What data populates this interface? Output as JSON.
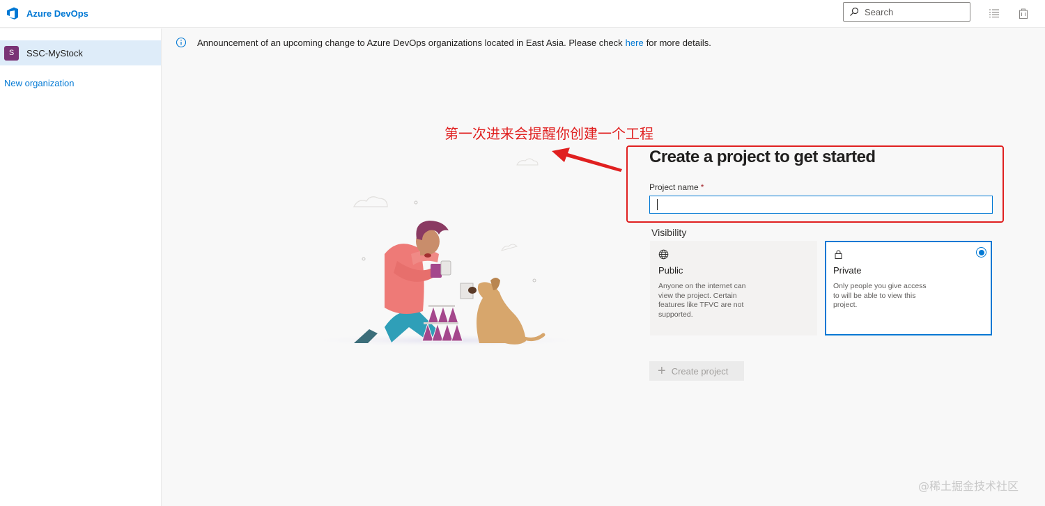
{
  "header": {
    "brand": "Azure DevOps",
    "search_placeholder": "Search",
    "icons": [
      "azure-devops-logo",
      "search-icon",
      "list-icon",
      "shopping-bag-icon"
    ]
  },
  "sidebar": {
    "org": {
      "initial": "S",
      "name": "SSC-MyStock"
    },
    "new_org": "New organization"
  },
  "announcement": {
    "before": "Announcement of an upcoming change to Azure DevOps organizations located in East Asia. Please check",
    "link": "here",
    "after": "for more details."
  },
  "annotation": {
    "text": "第一次进来会提醒你创建一个工程"
  },
  "form": {
    "title": "Create a project to get started",
    "project_name_label": "Project name",
    "required_mark": "*",
    "project_name_value": "",
    "visibility_label": "Visibility",
    "options": [
      {
        "title": "Public",
        "desc": "Anyone on the internet can view the project. Certain features like TFVC are not supported.",
        "icon": "globe-icon",
        "selected": false
      },
      {
        "title": "Private",
        "desc": "Only people you give access to will be able to view this project.",
        "icon": "lock-icon",
        "selected": true
      }
    ],
    "create_button": "Create project"
  },
  "watermark": "@稀土掘金技术社区",
  "colors": {
    "accent": "#0078d4",
    "annotation": "#e02020",
    "avatar": "#7a3476",
    "selected_bg": "#deecf9"
  }
}
